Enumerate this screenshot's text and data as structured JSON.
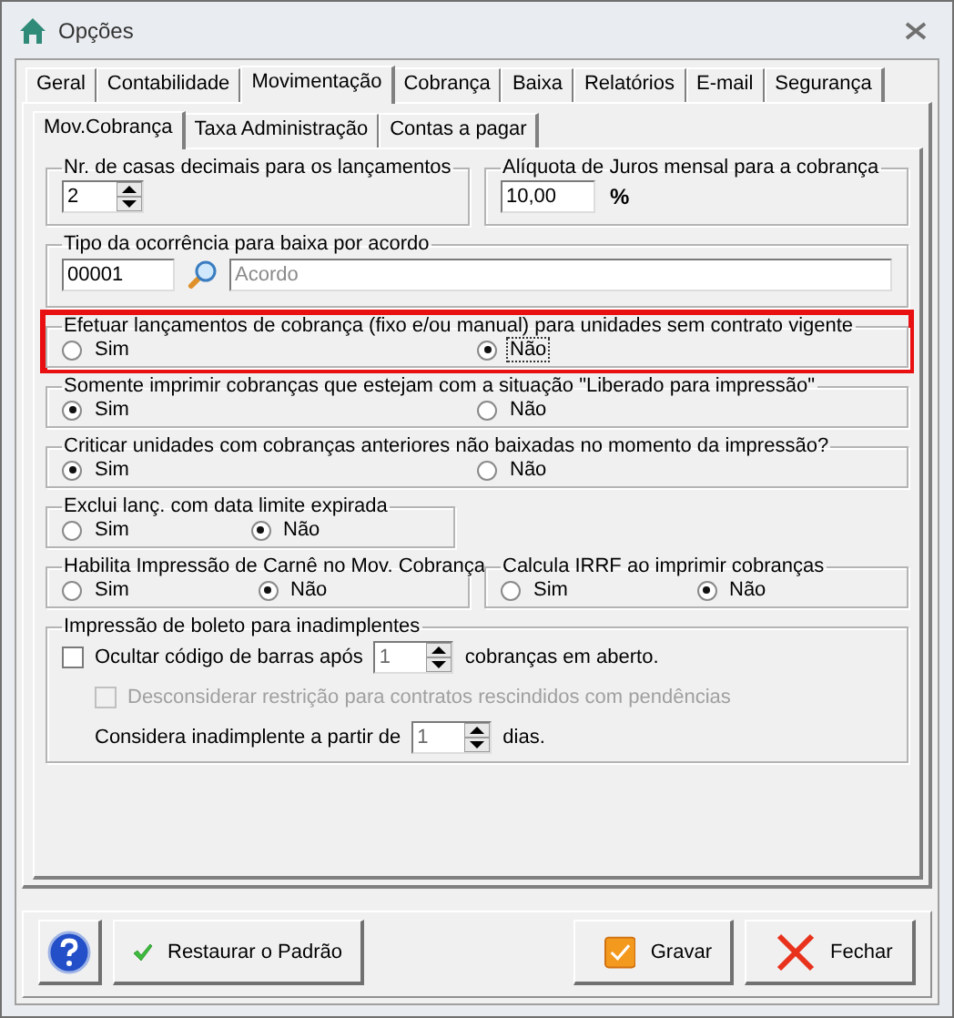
{
  "window": {
    "title": "Opções"
  },
  "tabs": [
    {
      "label": "Geral",
      "selected": false
    },
    {
      "label": "Contabilidade",
      "selected": false
    },
    {
      "label": "Movimentação",
      "selected": true
    },
    {
      "label": "Cobrança",
      "selected": false
    },
    {
      "label": "Baixa",
      "selected": false
    },
    {
      "label": "Relatórios",
      "selected": false
    },
    {
      "label": "E-mail",
      "selected": false
    },
    {
      "label": "Segurança",
      "selected": false
    }
  ],
  "subtabs": [
    {
      "label": "Mov.Cobrança",
      "selected": true
    },
    {
      "label": "Taxa Administração",
      "selected": false
    },
    {
      "label": "Contas a pagar",
      "selected": false
    }
  ],
  "rows": [
    {
      "groups": [
        {
          "kind": "spinner",
          "title": "Nr. de casas decimais para os lançamentos",
          "value": "2"
        },
        {
          "kind": "percent",
          "title": "Alíquota de Juros mensal para a cobrança",
          "value": "10,00",
          "unit": "%"
        }
      ]
    },
    {
      "groups": [
        {
          "kind": "lookup",
          "title": "Tipo da ocorrência para baixa por acordo",
          "code": "00001",
          "description": "Acordo"
        }
      ]
    },
    {
      "groups": [
        {
          "kind": "radio",
          "title": "Efetuar lançamentos de cobrança (fixo e/ou manual) para unidades sem contrato vigente",
          "highlighted": true,
          "options": [
            {
              "label": "Sim",
              "selected": false,
              "focused": false
            },
            {
              "label": "Não",
              "selected": true,
              "focused": true
            }
          ]
        }
      ]
    },
    {
      "groups": [
        {
          "kind": "radio",
          "title": "Somente imprimir cobranças que estejam com a situação \"Liberado para impressão\"",
          "highlighted": false,
          "options": [
            {
              "label": "Sim",
              "selected": true,
              "focused": false
            },
            {
              "label": "Não",
              "selected": false,
              "focused": false
            }
          ]
        }
      ]
    },
    {
      "groups": [
        {
          "kind": "radio",
          "title": "Criticar unidades com cobranças anteriores não baixadas no momento da impressão?",
          "highlighted": false,
          "options": [
            {
              "label": "Sim",
              "selected": true,
              "focused": false
            },
            {
              "label": "Não",
              "selected": false,
              "focused": false
            }
          ]
        }
      ]
    },
    {
      "groups": [
        {
          "kind": "radio",
          "title": "Exclui lanç. com data limite expirada",
          "highlighted": false,
          "options": [
            {
              "label": "Sim",
              "selected": false,
              "focused": false
            },
            {
              "label": "Não",
              "selected": true,
              "focused": false
            }
          ]
        }
      ]
    },
    {
      "groups": [
        {
          "kind": "radio",
          "title": "Habilita Impressão de Carnê no Mov. Cobrança",
          "highlighted": false,
          "options": [
            {
              "label": "Sim",
              "selected": false,
              "focused": false
            },
            {
              "label": "Não",
              "selected": true,
              "focused": false
            }
          ]
        },
        {
          "kind": "radio",
          "title": "Calcula IRRF ao imprimir cobranças",
          "highlighted": false,
          "options": [
            {
              "label": "Sim",
              "selected": false,
              "focused": false
            },
            {
              "label": "Não",
              "selected": true,
              "focused": false
            }
          ]
        }
      ]
    },
    {
      "groups": [
        {
          "kind": "boleto",
          "title": "Impressão de boleto para inadimplentes",
          "hide_barcode": {
            "label": "Ocultar código de barras após",
            "checked": false,
            "value": "1",
            "value_disabled": true,
            "suffix": "cobranças em aberto."
          },
          "ignore_restriction": {
            "label": "Desconsiderar restrição para contratos rescindidos com pendências",
            "checked": false,
            "disabled": true
          },
          "overdue": {
            "label": "Considera inadimplente a partir de",
            "value": "1",
            "value_disabled": true,
            "suffix": "dias."
          }
        }
      ]
    }
  ],
  "buttons": [
    {
      "kind": "help"
    },
    {
      "kind": "restore",
      "label": "Restaurar o Padrão"
    },
    {
      "kind": "save",
      "label": "Gravar"
    },
    {
      "kind": "close",
      "label": "Fechar"
    }
  ]
}
